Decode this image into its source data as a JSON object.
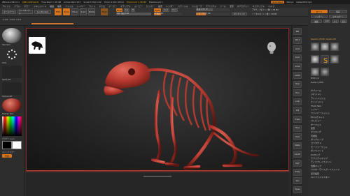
{
  "titlebar": {
    "app": "ZBrush 2022.0.1",
    "project": "[ZBrushProject]",
    "free_mem": "Free Mem 1.44 GB",
    "active_mem": "Active Mem 253",
    "scratch": "Scratch Disk 192",
    "timer": "Timer 0.001 ATime",
    "poly": "PolyCount 1.38 MP",
    "mesh": "MeshCount 1",
    "quicksave": "QuickSave",
    "menus": "Menus",
    "default": "DefaultZScript"
  },
  "menubar": {
    "items": [
      "アルファ",
      "ブラシ",
      "カラー",
      "ドキュメント",
      "描画",
      "編集",
      "ファイル",
      "レイヤー",
      "ライト",
      "マクロ",
      "マーカー",
      "マテリアル",
      "ムービー",
      "ピッカー",
      "設定",
      "レンダー",
      "ステンシル",
      "ストローク",
      "テクスチャ",
      "ツール",
      "変形",
      "Zプラグイン",
      "Zスクリプト",
      "ヘルプ"
    ]
  },
  "toolbar": {
    "home": "ホームページ",
    "lightbox": "ライトボックス",
    "liveboolean": "Live Boolean",
    "edit": "Edit",
    "draw": "Draw",
    "move": "Move",
    "scale": "Scale",
    "rotate": "Rotate",
    "mrgb": "Mrgb",
    "rgb": "Rgb",
    "m": "M",
    "zadd": "Zadd",
    "zsub": "Zsub",
    "zcut": "Zcut",
    "rgb_intensity": "Rgb 強度 100",
    "z_intensity": "Z 強度 25",
    "focal_shift": "焦点シフト 0",
    "draw_size": "ドローサイズ 64",
    "dynamic": "ダイナミック",
    "active_points": "アクティブポイント数: 1.38 Mil",
    "total_points": "トータルポイント数: 1.38 Mil",
    "coords": "-0.189, -0.081, 0.031"
  },
  "leftpanel": {
    "tool_label": "Standard",
    "stroke_label": "Dots",
    "alpha_label": "Alpha Off",
    "texture_label": "Texture Off",
    "material_label": "MatCap Red",
    "gradient_label": "グラデーション",
    "switch_label": "スイッチカラー",
    "alt_label": "代替"
  },
  "righttool": {
    "icons": [
      "BPR",
      "SPix 3",
      "Scroll",
      "Zoom",
      "Actual",
      "AAHalf",
      "Persp",
      "Floor",
      "Local",
      "XYZ",
      "Frame",
      "Move",
      "Scale",
      "Rotate",
      "Line Fill",
      "PolyF",
      "Transp",
      "Solo",
      "Xpose"
    ]
  },
  "rightpanel": {
    "header": [
      "ロード",
      "保存"
    ],
    "sub": [
      "インポート",
      "エクスポート",
      "複製",
      "GoZ",
      "全て",
      "表示",
      "R"
    ],
    "tool_name": "Skeleton_PM3D_Skeleton3D",
    "brushes": [
      "SimpleBrush",
      "Skeleton_PM3D",
      "PM3D_Sph",
      "Skeleton_PM3D",
      "PM3D_Cyl"
    ],
    "menu": [
      "サブツール",
      "ジオメトリ",
      "アレイメッシュ",
      "ナノメッシュ",
      "Thick Skin",
      "レイヤー",
      "ファイバーメッシュ",
      "HDジオメトリ",
      "プレビュー",
      "サーフェス",
      "変形",
      "マスキング",
      "可視性",
      "ポリグループ",
      "コンタクト",
      "モーファーゲット",
      "ポリペイント",
      "UVマップ",
      "テクスチャマップ",
      "ディスプレイスメント",
      "法線マップ",
      "ベクターディスプレイスメント",
      "表示設定",
      "ユニファイドスキン"
    ]
  },
  "colors": {
    "accent": "#d4751e",
    "model": "#b83a30",
    "frame": "#8a2a2a"
  }
}
